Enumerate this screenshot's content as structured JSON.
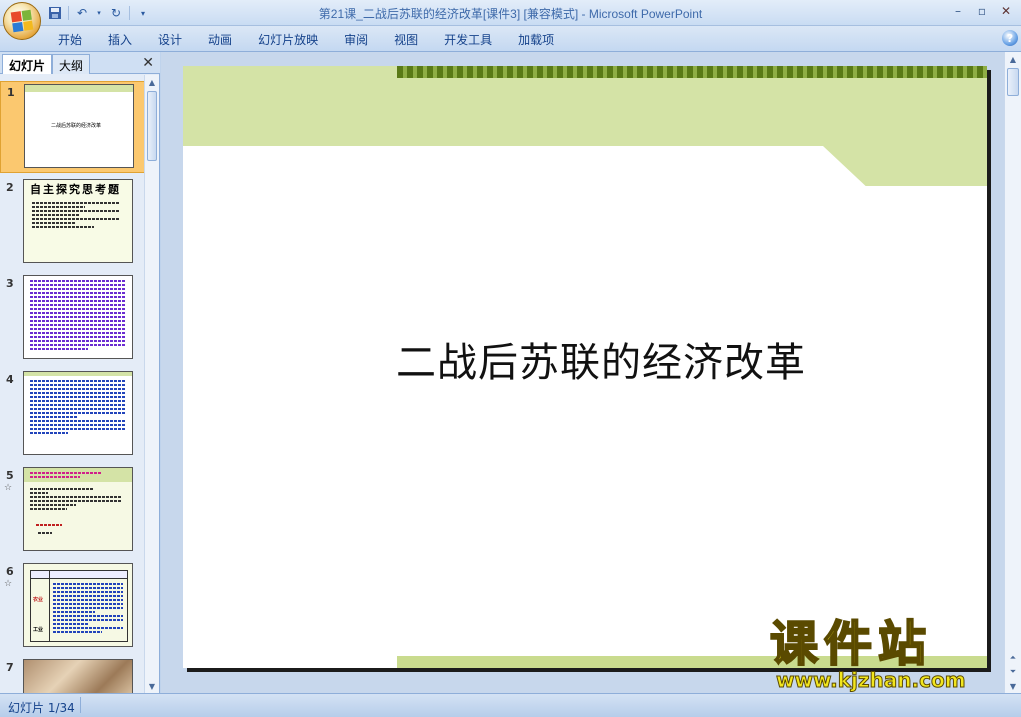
{
  "window": {
    "title": "第21课_二战后苏联的经济改革[课件3] [兼容模式] - Microsoft PowerPoint",
    "quick_access": [
      "save-icon",
      "undo-icon",
      "redo-icon",
      "customize-icon"
    ],
    "controls": [
      "minimize",
      "maximize",
      "close"
    ]
  },
  "ribbon": {
    "tabs": [
      "开始",
      "插入",
      "设计",
      "动画",
      "幻灯片放映",
      "审阅",
      "视图",
      "开发工具",
      "加载项"
    ]
  },
  "left_pane": {
    "tab_slides": "幻灯片",
    "tab_outline": "大纲",
    "close": "✕",
    "slides": [
      {
        "num": "1",
        "title": "二战后苏联的经济改革",
        "selected": true
      },
      {
        "num": "2",
        "title": "自主探究思考题",
        "anim": ""
      },
      {
        "num": "3",
        "anim": ""
      },
      {
        "num": "4",
        "anim": ""
      },
      {
        "num": "5",
        "anim": "☆"
      },
      {
        "num": "6",
        "anim": "☆",
        "table_labels": [
          "农业",
          "工业"
        ]
      },
      {
        "num": "7",
        "anim": ""
      }
    ]
  },
  "slide": {
    "title": "二战后苏联的经济改革"
  },
  "watermark": {
    "main": "课件站",
    "url": "www.kjzhan.com"
  },
  "status": {
    "slide_indicator": "幻灯片 1/34"
  }
}
